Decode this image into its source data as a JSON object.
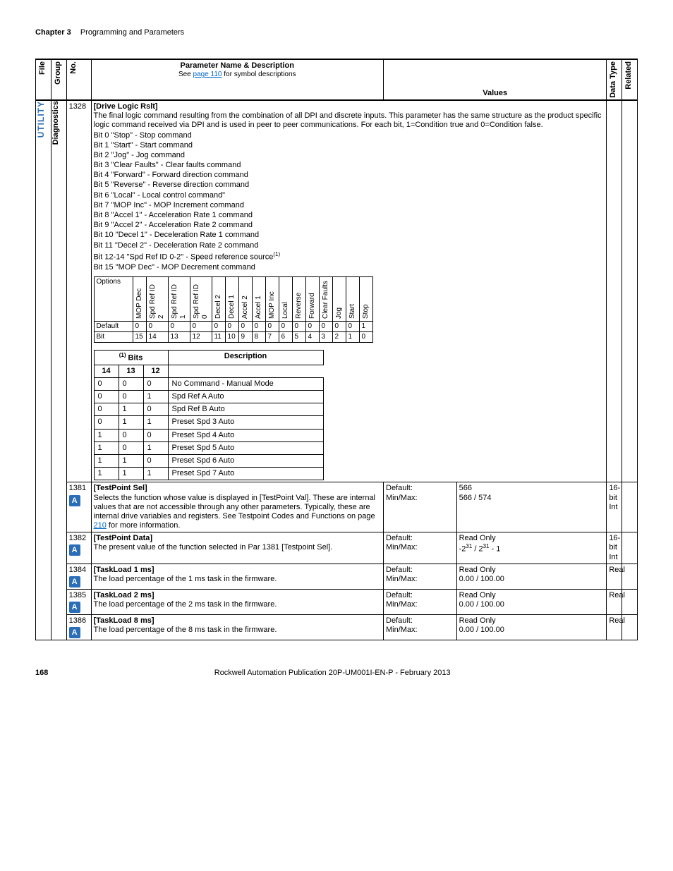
{
  "header": {
    "chapter": "Chapter 3",
    "section": "Programming and Parameters"
  },
  "columns": {
    "file": "File",
    "group": "Group",
    "no": "No.",
    "param_name": "Parameter Name & Description",
    "see_page": "See ",
    "see_page_link": "page 110",
    "see_page_after": " for symbol descriptions",
    "values": "Values",
    "data_type": "Data Type",
    "related": "Related"
  },
  "file_label": "UTILITY",
  "group_label": "Diagnostics",
  "p1328": {
    "no": "1328",
    "name": "[Drive Logic Rslt]",
    "desc": "The final logic command resulting from the combination of all DPI and discrete inputs. This parameter has the same structure as the product specific logic command received via DPI and is used in peer to peer communications. For each bit, 1=Condition true and 0=Condition false.",
    "bits": [
      "Bit 0 \"Stop\" - Stop command",
      "Bit 1 \"Start\" - Start command",
      "Bit 2 \"Jog\" - Jog command",
      "Bit 3 \"Clear Faults\" - Clear faults command",
      "Bit 4 \"Forward\" - Forward direction command",
      "Bit 5 \"Reverse\" - Reverse direction command",
      "Bit 6 \"Local\" - Local control command\"",
      "Bit 7 \"MOP Inc\" - MOP Increment command",
      "Bit 8 \"Accel 1\" - Acceleration Rate 1 command",
      "Bit 9 \"Accel 2\" - Acceleration Rate 2 command",
      "Bit 10 \"Decel 1\" - Deceleration Rate 1 command",
      "Bit 11 \"Decel 2\" - Deceleration Rate 2 command",
      "Bit 12-14 \"Spd Ref ID 0-2\" - Speed reference source",
      "Bit 15 \"MOP Dec\" - MOP Decrement command"
    ],
    "sup": "(1)",
    "options_label": "Options",
    "bit_headers": [
      "MOP Dec",
      "Spd Ref ID 2",
      "Spd Ref ID 1",
      "Spd Ref ID 0",
      "Decel 2",
      "Decel 1",
      "Accel 2",
      "Accel 1",
      "MOP Inc",
      "Local",
      "Reverse",
      "Forward",
      "Clear Faults",
      "Jog",
      "Start",
      "Stop"
    ],
    "default_label": "Default",
    "default_row": [
      "0",
      "0",
      "0",
      "0",
      "0",
      "0",
      "0",
      "0",
      "0",
      "0",
      "0",
      "0",
      "0",
      "0",
      "0",
      "1"
    ],
    "bit_label": "Bit",
    "bit_row": [
      "15",
      "14",
      "13",
      "12",
      "11",
      "10",
      "9",
      "8",
      "7",
      "6",
      "5",
      "4",
      "3",
      "2",
      "1",
      "0"
    ],
    "bits_table_header": {
      "bits": "Bits",
      "sup": "(1)",
      "desc": "Description",
      "h14": "14",
      "h13": "13",
      "h12": "12"
    },
    "bits_rows": [
      {
        "c14": "0",
        "c13": "0",
        "c12": "0",
        "desc": "No Command - Manual Mode"
      },
      {
        "c14": "0",
        "c13": "0",
        "c12": "1",
        "desc": "Spd Ref A Auto"
      },
      {
        "c14": "0",
        "c13": "1",
        "c12": "0",
        "desc": "Spd Ref B Auto"
      },
      {
        "c14": "0",
        "c13": "1",
        "c12": "1",
        "desc": "Preset Spd 3 Auto"
      },
      {
        "c14": "1",
        "c13": "0",
        "c12": "0",
        "desc": "Preset Spd 4 Auto"
      },
      {
        "c14": "1",
        "c13": "0",
        "c12": "1",
        "desc": "Preset Spd 5 Auto"
      },
      {
        "c14": "1",
        "c13": "1",
        "c12": "0",
        "desc": "Preset Spd 6 Auto"
      },
      {
        "c14": "1",
        "c13": "1",
        "c12": "1",
        "desc": "Preset Spd 7 Auto"
      }
    ]
  },
  "p1381": {
    "no": "1381",
    "name": "[TestPoint Sel]",
    "desc": "Selects the function whose value is displayed in [TestPoint Val]. These are internal values that are not accessible through any other parameters. Typically, these are internal drive variables and registers. See Testpoint Codes and Functions on page ",
    "link": "210",
    "desc_after": " for more information.",
    "default_label": "Default:",
    "default_val": "566",
    "minmax_label": "Min/Max:",
    "minmax_val": "566 / 574",
    "dtype": "16-bit Int"
  },
  "p1382": {
    "no": "1382",
    "name": "[TestPoint Data]",
    "desc": "The present value of the function selected in Par 1381 [Testpoint Sel].",
    "default_label": "Default:",
    "default_val": "Read Only",
    "minmax_label": "Min/Max:",
    "minmax_val_pre": "-2",
    "minmax_sup1": "31",
    "minmax_mid": " / 2",
    "minmax_sup2": "31",
    "minmax_post": " - 1",
    "dtype": "16-bit Int"
  },
  "p1384": {
    "no": "1384",
    "name": "[TaskLoad 1 ms]",
    "desc": "The load percentage of the 1 ms task in the firmware.",
    "default_label": "Default:",
    "default_val": "Read Only",
    "minmax_label": "Min/Max:",
    "minmax_val": "0.00 / 100.00",
    "dtype": "Real"
  },
  "p1385": {
    "no": "1385",
    "name": "[TaskLoad 2 ms]",
    "desc": "The load percentage of the 2 ms task in the firmware.",
    "default_label": "Default:",
    "default_val": "Read Only",
    "minmax_label": "Min/Max:",
    "minmax_val": "0.00 / 100.00",
    "dtype": "Real"
  },
  "p1386": {
    "no": "1386",
    "name": "[TaskLoad 8 ms]",
    "desc": "The load percentage of the 8 ms task in the firmware.",
    "default_label": "Default:",
    "default_val": "Read Only",
    "minmax_label": "Min/Max:",
    "minmax_val": "0.00 / 100.00",
    "dtype": "Real"
  },
  "footer": {
    "page": "168",
    "pub": "Rockwell Automation Publication 20P-UM001I-EN-P - February 2013"
  },
  "icon_a": "A"
}
